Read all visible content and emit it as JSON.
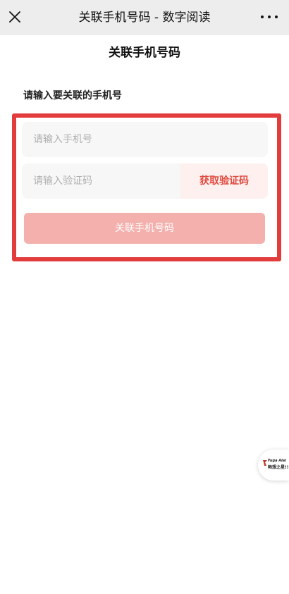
{
  "topbar": {
    "title": "关联手机号码 - 数字阅读",
    "close_icon": "close-icon",
    "more_icon": "more-dots-icon"
  },
  "page": {
    "title": "关联手机号码",
    "section_label": "请输入要关联的手机号"
  },
  "form": {
    "phone_placeholder": "请输入手机号",
    "phone_value": "",
    "code_placeholder": "请输入验证码",
    "code_value": "",
    "get_code_label": "获取验证码",
    "submit_label": "关联手机号码"
  },
  "float_badge": {
    "sub_text": "Fuga Alai",
    "main_text": "畅想之星!!"
  },
  "colors": {
    "accent": "#e04a3f",
    "highlight_border": "#e23c3c",
    "submit_disabled": "#f4b0ad",
    "input_bg": "#f7f7f7",
    "topbar_bg": "#ededed"
  }
}
